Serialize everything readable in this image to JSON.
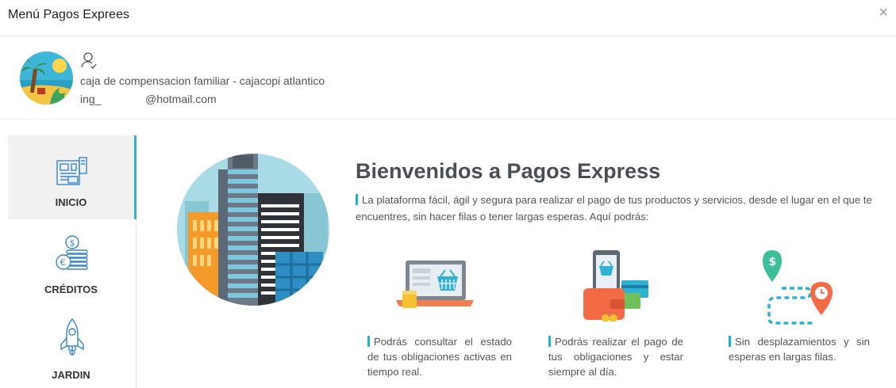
{
  "modal": {
    "title": "Menú Pagos Exprees",
    "close_label": "×"
  },
  "profile": {
    "organization": "caja de compensacion familiar - cajacopi atlantico",
    "email_prefix": "ing_",
    "email_domain": "@hotmail.com"
  },
  "sidebar": {
    "items": [
      {
        "label": "INICIO",
        "icon": "dashboard-icon",
        "active": true
      },
      {
        "label": "CRÉDITOS",
        "icon": "coins-icon",
        "active": false
      },
      {
        "label": "JARDIN",
        "icon": "rocket-icon",
        "active": false
      }
    ]
  },
  "main": {
    "title": "Bienvenidos a Pagos Express",
    "intro": "La plataforma fácil, ágil y segura para realizar el pago de tus productos y servicios, desde el lugar en el que te encuentres, sin hacer filas o tener largas esperas. Aquí podrás:",
    "features": [
      {
        "icon": "laptop-basket-icon",
        "text": "Podrás consultar el estado de tus obligaciones activas en tiempo real."
      },
      {
        "icon": "phone-wallet-icon",
        "text": "Podrás realizar el pago de tus obligaciones y estar siempre al día."
      },
      {
        "icon": "route-pins-icon",
        "text": "Sin desplazamientos y sin esperas en largas filas."
      }
    ]
  },
  "colors": {
    "accent": "#1fb3d4",
    "active_bg": "#f1f1f1"
  }
}
